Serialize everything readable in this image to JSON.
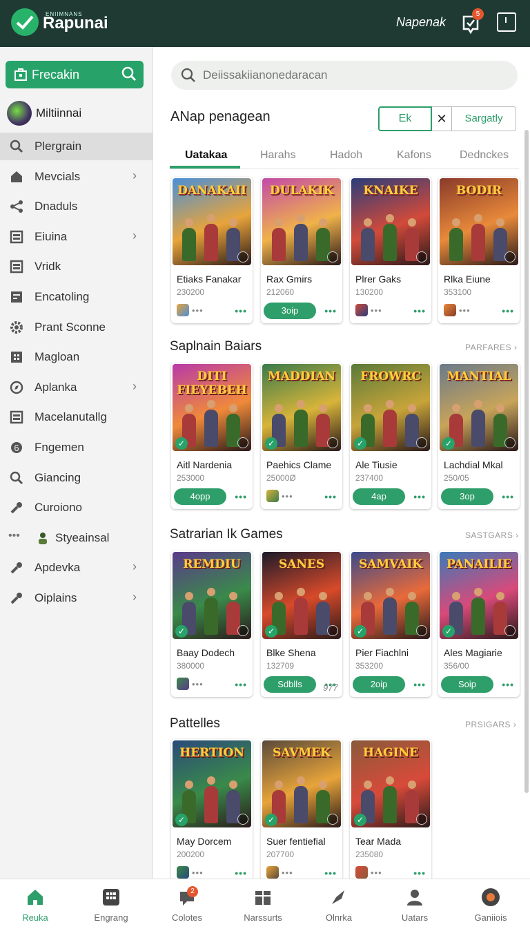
{
  "topbar": {
    "logo_small": "ENIIMNANS",
    "logo_text": "Rapunai",
    "user_name": "Napenak",
    "notif_count": "5"
  },
  "sidebar": {
    "search_label": "Frecakin",
    "user_name": "Miltiinnai",
    "items": [
      {
        "label": "Plergrain",
        "icon": "search-icon",
        "chevron": false,
        "active": true
      },
      {
        "label": "Mevcials",
        "icon": "home-icon",
        "chevron": true
      },
      {
        "label": "Dnaduls",
        "icon": "share-icon",
        "chevron": false
      },
      {
        "label": "Eiuina",
        "icon": "list-icon",
        "chevron": true
      },
      {
        "label": "Vridk",
        "icon": "list-icon",
        "chevron": false
      },
      {
        "label": "Encatoling",
        "icon": "doc-icon",
        "chevron": false
      },
      {
        "label": "Prant Sconne",
        "icon": "gear-icon",
        "chevron": false
      },
      {
        "label": "Magloan",
        "icon": "grid-icon",
        "chevron": false
      },
      {
        "label": "Aplanka",
        "icon": "compass-icon",
        "chevron": true
      },
      {
        "label": "Macelanutallg",
        "icon": "list-icon",
        "chevron": false
      },
      {
        "label": "Fngemen",
        "icon": "six-icon",
        "chevron": false
      },
      {
        "label": "Giancing",
        "icon": "search-icon",
        "chevron": false
      },
      {
        "label": "Curoiono",
        "icon": "wrench-icon",
        "chevron": false
      },
      {
        "label": "Styeainsal",
        "icon": "avatar-icon",
        "chevron": false
      },
      {
        "label": "Apdevka",
        "icon": "wrench-icon",
        "chevron": true
      },
      {
        "label": "Oiplains",
        "icon": "wrench-icon",
        "chevron": true
      }
    ]
  },
  "main": {
    "search_placeholder": "Deiissakiianonedaracan",
    "section_head": "ANap penagean",
    "seg_left": "Ek",
    "seg_close": "✕",
    "seg_right": "Sargatly",
    "tabs": [
      "Uatakaa",
      "Harahs",
      "Hadoh",
      "Kafons",
      "Dednckes"
    ],
    "rows": [
      {
        "title": "",
        "more": "",
        "cards": [
          {
            "art_title": "DANAKAII",
            "name": "Etiaks Fanakar",
            "num": "230200",
            "pill": "",
            "colors": [
              "#4a8fd8",
              "#e8a43a"
            ]
          },
          {
            "art_title": "DULAKIK",
            "name": "Rax Gmirs",
            "num": "212060",
            "pill": "3oip",
            "colors": [
              "#c34aa8",
              "#f0b24a"
            ]
          },
          {
            "art_title": "KNAIKE",
            "name": "Plrer Gaks",
            "num": "130200",
            "pill": "",
            "colors": [
              "#2a3d7a",
              "#d24a3a"
            ]
          },
          {
            "art_title": "BODIR",
            "name": "Rlka Eiune",
            "num": "353100",
            "pill": "",
            "colors": [
              "#8a3a2a",
              "#e88a3a"
            ]
          }
        ]
      },
      {
        "title": "Saplnain Baiars",
        "more": "PARFARES ›",
        "cards": [
          {
            "art_title": "DITI FIEYEBEH",
            "name": "Aitl Nardenia",
            "num": "253000",
            "pill": "4opp",
            "colors": [
              "#b83aa8",
              "#f08a3a"
            ]
          },
          {
            "art_title": "MADDIAN",
            "name": "Paehics Clame",
            "num": "25000Ø",
            "pill": "",
            "colors": [
              "#3a7a4a",
              "#d8b43a"
            ]
          },
          {
            "art_title": "FROWRC",
            "name": "Ale Tiusie",
            "num": "237400",
            "pill": "4ap",
            "colors": [
              "#5a7a3a",
              "#c8a43a"
            ]
          },
          {
            "art_title": "MANTIAL",
            "name": "Lachdial Mkal",
            "num": "250/05",
            "pill": "3op",
            "colors": [
              "#6a7a8a",
              "#c8a45a"
            ]
          }
        ]
      },
      {
        "title": "Satrarian Ik Games",
        "more": "SASTGARS ›",
        "cards": [
          {
            "art_title": "REMDIU",
            "name": "Baay Dodech",
            "num": "380000",
            "pill": "",
            "colors": [
              "#5a3a8a",
              "#3a8a4a"
            ]
          },
          {
            "art_title": "SANES",
            "name": "Blke Shena",
            "num": "132709",
            "pill": "Sdblls",
            "colors": [
              "#1a1a2a",
              "#d84a2a"
            ]
          },
          {
            "art_title": "SAMVAIK",
            "name": "Pier Fiachlni",
            "num": "353200",
            "pill": "2oip",
            "colors": [
              "#3a4a8a",
              "#e86a3a"
            ]
          },
          {
            "art_title": "PANAILIE",
            "name": "Ales Magiarie",
            "num": "356/00",
            "pill": "Soip",
            "colors": [
              "#3a7ab8",
              "#d84a7a"
            ]
          }
        ]
      },
      {
        "title": "Pattelles",
        "more": "PRSIGARS ›",
        "cards": [
          {
            "art_title": "HERTION",
            "name": "May Dorcem",
            "num": "200200",
            "pill": "",
            "colors": [
              "#2a4a7a",
              "#3a8a4a"
            ]
          },
          {
            "art_title": "SAVMEK",
            "name": "Suer fentiefial",
            "num": "207700",
            "pill": "",
            "colors": [
              "#5a4a3a",
              "#e8a43a"
            ]
          },
          {
            "art_title": "HAGINE",
            "name": "Tear Mada",
            "num": "235080",
            "pill": "",
            "colors": [
              "#8a5a3a",
              "#d84a3a"
            ]
          }
        ]
      }
    ],
    "extra_num": "977"
  },
  "bottomnav": {
    "badge": "2",
    "items": [
      {
        "label": "Reuka",
        "icon": "home-icon",
        "active": true
      },
      {
        "label": "Engrang",
        "icon": "grid-icon"
      },
      {
        "label": "Colotes",
        "icon": "chat-icon"
      },
      {
        "label": "Narssurts",
        "icon": "store-icon"
      },
      {
        "label": "Olnrka",
        "icon": "rocket-icon"
      },
      {
        "label": "Uatars",
        "icon": "user-icon"
      },
      {
        "label": "Ganiiois",
        "icon": "record-icon"
      }
    ]
  },
  "colors": {
    "accent": "#2e9e6a",
    "topbar": "#1f3a33",
    "badge": "#e4572e"
  }
}
